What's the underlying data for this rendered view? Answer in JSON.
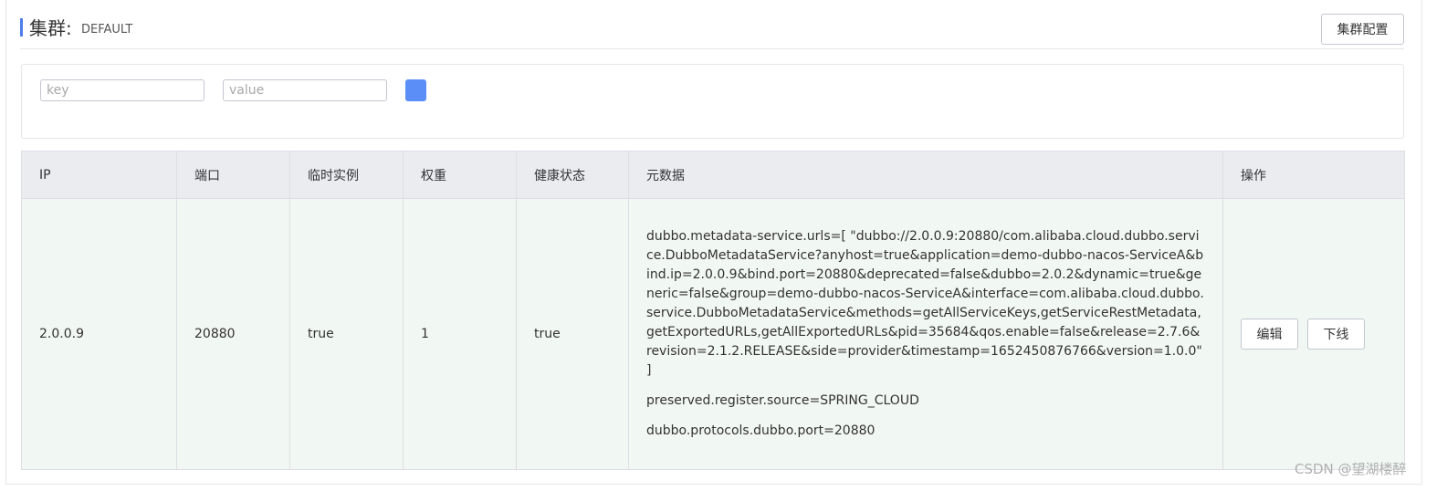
{
  "header": {
    "title": "集群:",
    "cluster_name": "DEFAULT",
    "config_button": "集群配置"
  },
  "filter": {
    "key_placeholder": "key",
    "value_placeholder": "value"
  },
  "table": {
    "columns": [
      "IP",
      "端口",
      "临时实例",
      "权重",
      "健康状态",
      "元数据",
      "操作"
    ],
    "rows": [
      {
        "ip": "2.0.0.9",
        "port": "20880",
        "ephemeral": "true",
        "weight": "1",
        "healthy": "true",
        "metadata": [
          "dubbo.metadata-service.urls=[ \"dubbo://2.0.0.9:20880/com.alibaba.cloud.dubbo.service.DubboMetadataService?anyhost=true&application=demo-dubbo-nacos-ServiceA&bind.ip=2.0.0.9&bind.port=20880&deprecated=false&dubbo=2.0.2&dynamic=true&generic=false&group=demo-dubbo-nacos-ServiceA&interface=com.alibaba.cloud.dubbo.service.DubboMetadataService&methods=getAllServiceKeys,getServiceRestMetadata,getExportedURLs,getAllExportedURLs&pid=35684&qos.enable=false&release=2.7.6&revision=2.1.2.RELEASE&side=provider&timestamp=1652450876766&version=1.0.0\" ]",
          "preserved.register.source=SPRING_CLOUD",
          "dubbo.protocols.dubbo.port=20880"
        ],
        "actions": {
          "edit": "编辑",
          "offline": "下线"
        }
      }
    ]
  },
  "watermark": "CSDN @望湖楼醉"
}
